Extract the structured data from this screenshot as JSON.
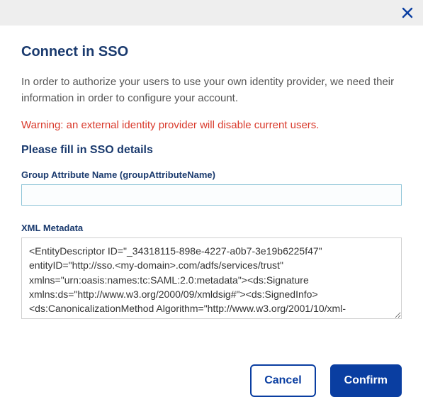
{
  "header": {
    "title": "Connect in SSO"
  },
  "body": {
    "intro": "In order to authorize your users to use your own identity provider, we need their information in order to configure your account.",
    "warning": "Warning: an external identity provider will disable current users.",
    "subheading": "Please fill in SSO details",
    "group_attribute": {
      "label": "Group Attribute Name (groupAttributeName)",
      "value": ""
    },
    "xml_metadata": {
      "label": "XML Metadata",
      "value": "<EntityDescriptor ID=\"_34318115-898e-4227-a0b7-3e19b6225f47\" entityID=\"http://sso.<my-domain>.com/adfs/services/trust\" xmlns=\"urn:oasis:names:tc:SAML:2.0:metadata\"><ds:Signature xmlns:ds=\"http://www.w3.org/2000/09/xmldsig#\"><ds:SignedInfo><ds:CanonicalizationMethod Algorithm=\"http://www.w3.org/2001/10/xml-"
    }
  },
  "footer": {
    "cancel_label": "Cancel",
    "confirm_label": "Confirm"
  }
}
